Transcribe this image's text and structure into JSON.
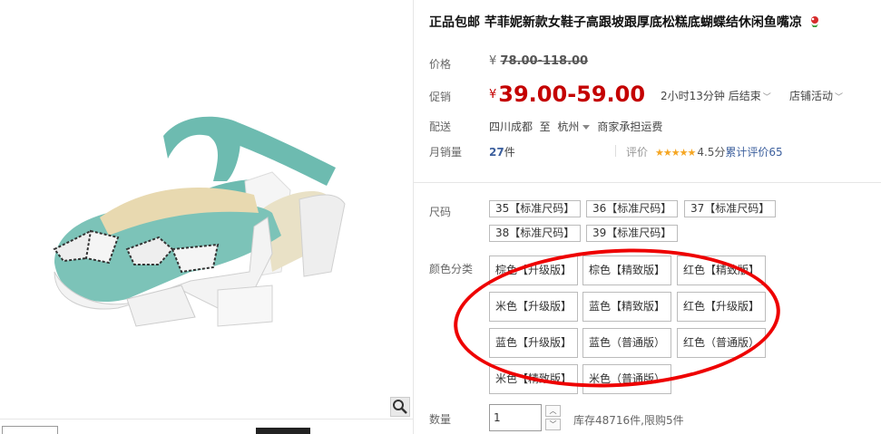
{
  "product": {
    "title": "正品包邮 芊菲妮新款女鞋子高跟坡跟厚底松糕底蝴蝶结休闲鱼嘴凉"
  },
  "price": {
    "label": "价格",
    "currency": "¥",
    "original": "78.00-118.00"
  },
  "promo": {
    "label": "促销",
    "currency": "¥",
    "price": "39.00-59.00",
    "timer": "2小时13分钟 后结束",
    "shop_activity": "店铺活动"
  },
  "shipping": {
    "label": "配送",
    "origin": "四川成都",
    "to": "至",
    "destination": "杭州",
    "fee_note": "商家承担运费"
  },
  "sales": {
    "label": "月销量",
    "count": "27",
    "unit": "件",
    "review_label": "评价",
    "stars": "★★★★★",
    "rating": 4.5,
    "score": "4.5分",
    "review_link": "累计评价65"
  },
  "size": {
    "label": "尺码",
    "options": [
      "35【标准尺码】",
      "36【标准尺码】",
      "37【标准尺码】",
      "38【标准尺码】",
      "39【标准尺码】"
    ]
  },
  "color": {
    "label": "颜色分类",
    "options": [
      "棕色【升级版】",
      "棕色【精致版】",
      "红色【精致版】",
      "米色【升级版】",
      "蓝色【精致版】",
      "红色【升级版】",
      "蓝色【升级版】",
      "蓝色（普通版）",
      "红色（普通版）",
      "米色【精致版】",
      "米色（普通版）"
    ]
  },
  "quantity": {
    "label": "数量",
    "value": "1",
    "stock_note": "库存48716件,限购5件"
  },
  "annotation": {
    "color": "#e00000"
  },
  "colors": {
    "promo": "#c40000",
    "link": "#3c5f9d",
    "star": "#f5a623"
  }
}
